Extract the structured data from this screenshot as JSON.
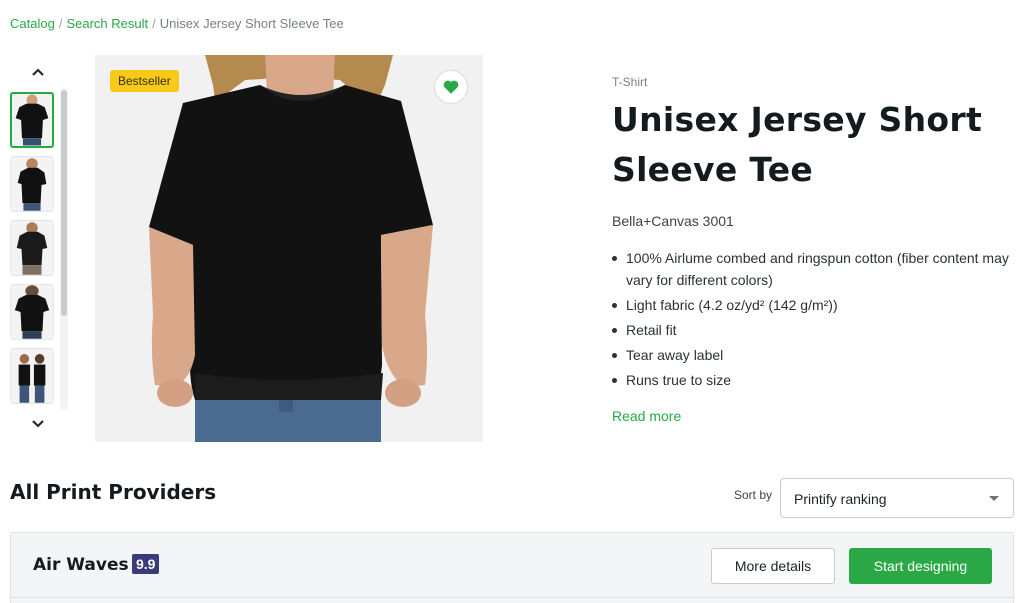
{
  "breadcrumb": {
    "items": [
      "Catalog",
      "Search Result",
      "Unisex Jersey Short Sleeve Tee"
    ],
    "separator": "/"
  },
  "gallery": {
    "badge": "Bestseller",
    "thumbnail_count": 5,
    "active_thumbnail": 0,
    "icons": {
      "up": "chevron-up-icon",
      "down": "chevron-down-icon",
      "favorite": "heart-icon"
    }
  },
  "product": {
    "category": "T-Shirt",
    "title": "Unisex Jersey Short Sleeve Tee",
    "model": "Bella+Canvas 3001",
    "features": [
      "100% Airlume combed and ringspun cotton (fiber content may vary for different colors)",
      "Light fabric (4.2 oz/yd² (142 g/m²))",
      "Retail fit",
      "Tear away label",
      "Runs true to size"
    ],
    "read_more": "Read more"
  },
  "providers": {
    "heading": "All Print Providers",
    "sort_label": "Sort by",
    "sort_value": "Printify ranking",
    "items": [
      {
        "name": "Air Waves",
        "score": "9.9",
        "more_label": "More details",
        "start_label": "Start designing"
      }
    ]
  },
  "colors": {
    "accent": "#29a845",
    "badge": "#f7ca1a",
    "score_bg": "#3b3a7a"
  }
}
